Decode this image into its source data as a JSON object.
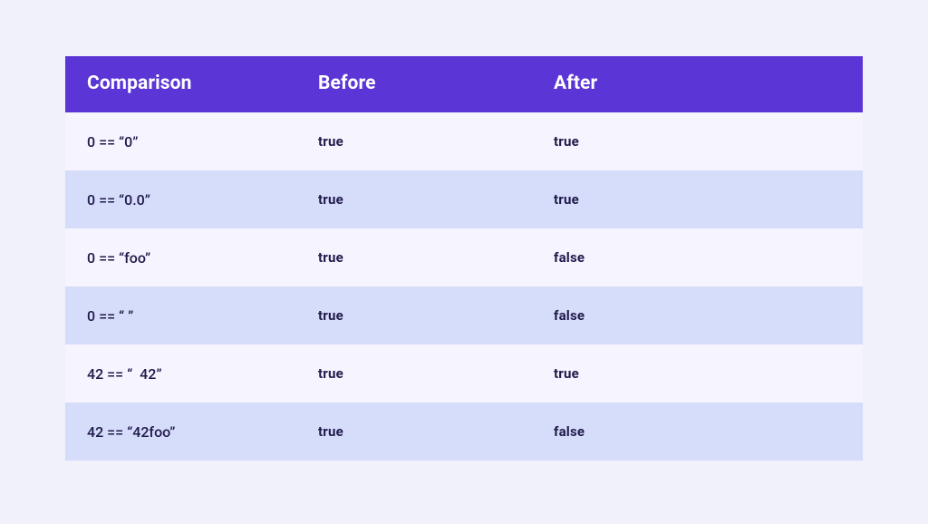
{
  "colors": {
    "background": "#f1f1fb",
    "header_bg": "#5b35d5",
    "header_text": "#ffffff",
    "row_odd": "#f6f4ff",
    "row_even": "#d6ddfb",
    "text": "#201a4a"
  },
  "table": {
    "headers": {
      "comparison": "Comparison",
      "before": "Before",
      "after": "After"
    },
    "rows": [
      {
        "comparison": "0 == “0”",
        "before": "true",
        "after": "true"
      },
      {
        "comparison": "0 == “0.0”",
        "before": "true",
        "after": "true"
      },
      {
        "comparison": "0 == “foo”",
        "before": "true",
        "after": "false"
      },
      {
        "comparison": "0 == “ ”",
        "before": "true",
        "after": "false"
      },
      {
        "comparison": "42 == “  42”",
        "before": "true",
        "after": "true"
      },
      {
        "comparison": "42 == “42foo”",
        "before": "true",
        "after": "false"
      }
    ]
  }
}
